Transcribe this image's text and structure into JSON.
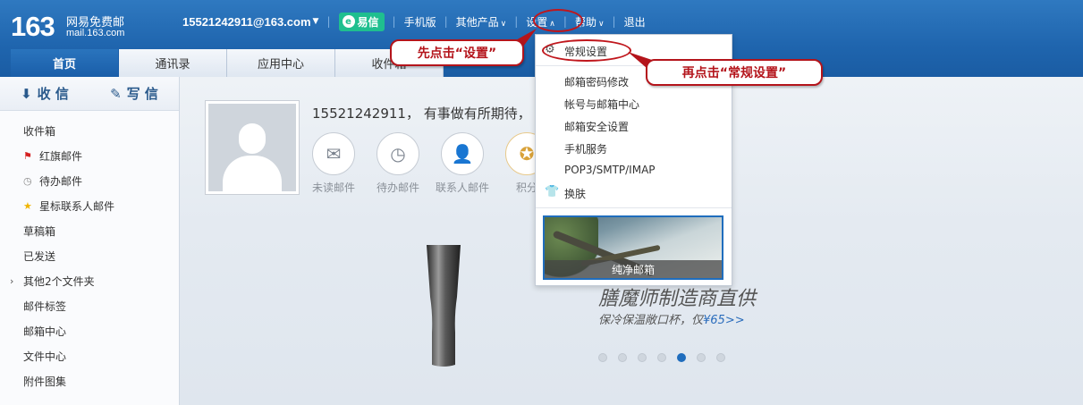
{
  "logo": {
    "number": "163",
    "line1": "网易免费邮",
    "line2": "mail.163.com"
  },
  "topnav": {
    "email": "15521242911@163.com",
    "yixin": "易信",
    "mobile": "手机版",
    "other_products": "其他产品",
    "settings": "设置",
    "help": "帮助",
    "logout": "退出"
  },
  "tabs": [
    "首页",
    "通讯录",
    "应用中心",
    "收件箱"
  ],
  "sidebar": {
    "receive": "收 信",
    "compose": "写 信",
    "items": [
      "收件箱",
      "红旗邮件",
      "待办邮件",
      "星标联系人邮件",
      "草稿箱",
      "已发送",
      "其他2个文件夹",
      "邮件标签",
      "邮箱中心",
      "文件中心",
      "附件图集"
    ]
  },
  "main": {
    "greeting": "15521242911， 有事做有所期待，",
    "quick": [
      "未读邮件",
      "待办邮件",
      "联系人邮件",
      "积分"
    ],
    "promo_title": "膳魔师制造商直供",
    "promo_sub": "保冷保温敞口杯，仅",
    "promo_price": "¥65>>",
    "carousel_count": 7,
    "carousel_active": 5
  },
  "dropdown": {
    "items": [
      "常规设置",
      "邮箱密码修改",
      "帐号与邮箱中心",
      "邮箱安全设置",
      "手机服务",
      "POP3/SMTP/IMAP",
      "换肤"
    ],
    "skin_label": "纯净邮箱"
  },
  "annotations": {
    "step1": "先点击“设置”",
    "step2": "再点击“常规设置”",
    "color": "#b4141b"
  }
}
